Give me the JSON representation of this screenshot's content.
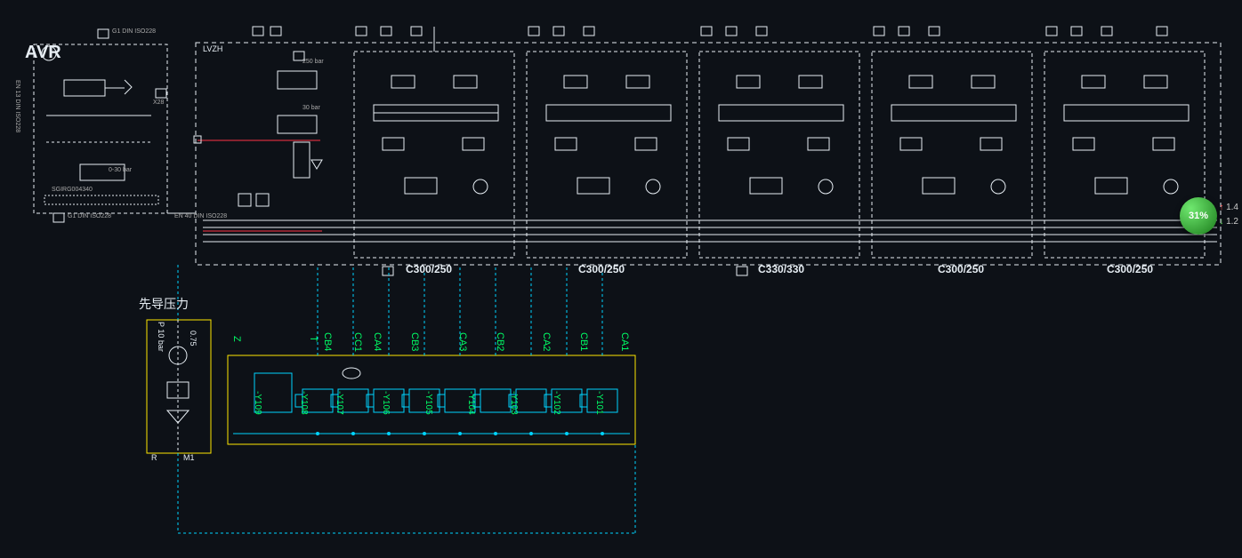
{
  "badge": {
    "percent": "31%"
  },
  "stats": {
    "up": "1.4",
    "down": "1.2"
  },
  "avr_block": {
    "title": "AVR",
    "top_port": "G1 DIN ISO228",
    "bot_port": "G1 DIN ISO228",
    "left_label": "EN 13 DIN ISO228",
    "part_no": "SGIRG004340",
    "pressure": "0-30 bar",
    "right_port": "X28"
  },
  "manifold": {
    "label_lvzh": "LVZH",
    "label_cn": "EN 40 DIN ISO228",
    "pressure1": "30 bar",
    "pressure2": "250 bar"
  },
  "sections": [
    {
      "label": "C300/250"
    },
    {
      "label": "C300/250"
    },
    {
      "label": "C330/330"
    },
    {
      "label": "C300/250"
    },
    {
      "label": "C300/250"
    }
  ],
  "pilot": {
    "title": "先导压力",
    "p_label": "P 10 bar",
    "r_label": "R",
    "m1": "M1",
    "acc": "0.75"
  },
  "valve_bank": {
    "z": "Z",
    "t": "T",
    "ports": [
      "CB4",
      "CC1",
      "CA4",
      "CB3",
      "CA3",
      "CB2",
      "CA2",
      "CB1",
      "CA1"
    ],
    "coils": [
      "-Y109",
      "-Y108",
      "-Y107",
      "-Y106",
      "-Y105",
      "-Y104",
      "-Y103",
      "-Y102",
      "-Y101"
    ]
  }
}
